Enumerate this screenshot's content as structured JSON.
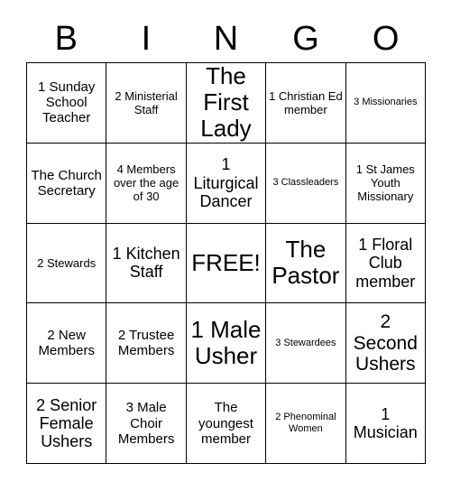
{
  "card": {
    "header_letters": [
      "B",
      "I",
      "N",
      "G",
      "O"
    ],
    "free_space_label": "FREE!",
    "colors": {
      "background": "#ffffff",
      "border": "#000000",
      "text": "#000000"
    },
    "rows": [
      [
        {
          "text": "1 Sunday School Teacher",
          "size": "m"
        },
        {
          "text": "2 Ministerial Staff",
          "size": "s"
        },
        {
          "text": "The First Lady",
          "size": "xxl"
        },
        {
          "text": "1 Christian Ed member",
          "size": "s"
        },
        {
          "text": "3 Missionaries",
          "size": "xs"
        }
      ],
      [
        {
          "text": "The Church Secretary",
          "size": "m"
        },
        {
          "text": "4 Members over the age of 30",
          "size": "s"
        },
        {
          "text": "1 Liturgical Dancer",
          "size": "l"
        },
        {
          "text": "3 Classleaders",
          "size": "xs"
        },
        {
          "text": "1 St James Youth Missionary",
          "size": "s"
        }
      ],
      [
        {
          "text": "2 Stewards",
          "size": "s"
        },
        {
          "text": "1 Kitchen Staff",
          "size": "l"
        },
        {
          "text": "FREE!",
          "size": "xxl"
        },
        {
          "text": "The Pastor",
          "size": "xxl"
        },
        {
          "text": "1 Floral Club member",
          "size": "l"
        }
      ],
      [
        {
          "text": "2 New Members",
          "size": "m"
        },
        {
          "text": "2 Trustee Members",
          "size": "m"
        },
        {
          "text": "1 Male Usher",
          "size": "xxl"
        },
        {
          "text": "3 Stewardees",
          "size": "xs"
        },
        {
          "text": "2 Second Ushers",
          "size": "xl"
        }
      ],
      [
        {
          "text": "2 Senior Female Ushers",
          "size": "l"
        },
        {
          "text": "3 Male Choir Members",
          "size": "m"
        },
        {
          "text": "The youngest member",
          "size": "m"
        },
        {
          "text": "2 Phenominal Women",
          "size": "xs"
        },
        {
          "text": "1 Musician",
          "size": "l"
        }
      ]
    ]
  }
}
